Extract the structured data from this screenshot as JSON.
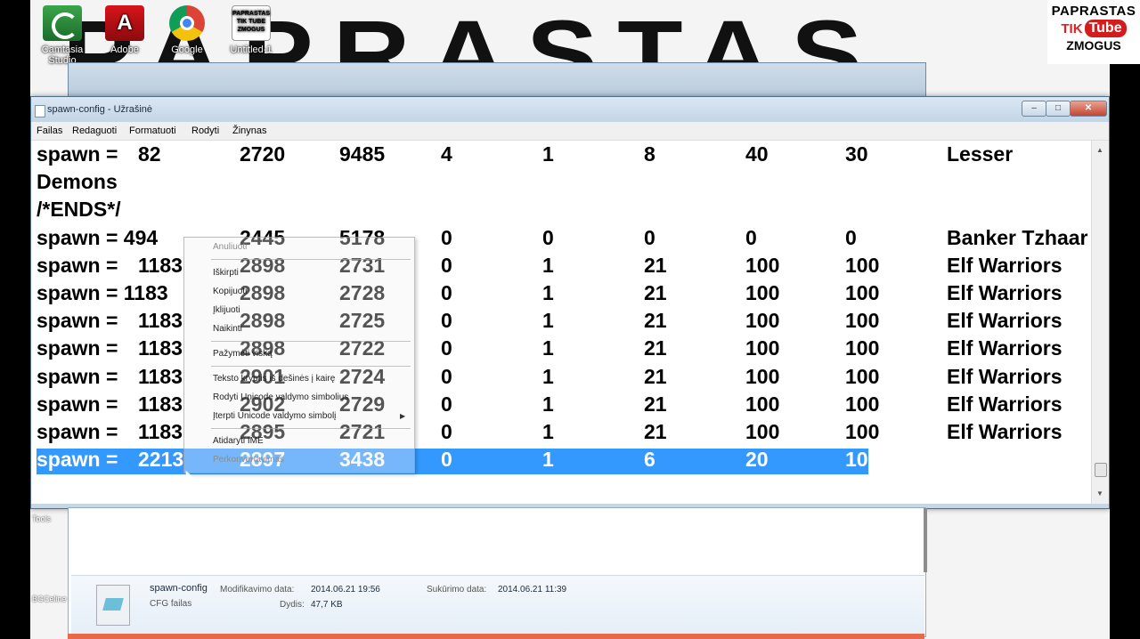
{
  "desktop": {
    "wallpaper_text": "PAPRASTAS",
    "icons": [
      {
        "label": "Camtasia Studio",
        "icon": "camtasia-icon"
      },
      {
        "label": "Adobe",
        "icon": "adobe-icon"
      },
      {
        "label": "Google",
        "icon": "chrome-icon"
      },
      {
        "label": "Untitled-1",
        "icon": "untitled-icon"
      }
    ],
    "untitled_thumb_text": "PAPRASTAS TIK TUBE ZMOGUS",
    "left_icons": [
      "Tools",
      "BGCeline"
    ]
  },
  "logo": {
    "line1": "PAPRASTAS",
    "tik": "TIK",
    "tube": "Tube",
    "line3": "ZMOGUS"
  },
  "notepad": {
    "title": "spawn-config - Užrašinė",
    "controls": {
      "minimize": "–",
      "maximize": "□",
      "close": "✕"
    },
    "menu": [
      "Failas",
      "Redaguoti",
      "Formatuoti",
      "Rodyti",
      "Žinynas"
    ],
    "lines": [
      [
        "spawn =",
        "82",
        "2720",
        "9485",
        "4",
        "1",
        "8",
        "40",
        "30",
        "Lesser"
      ],
      [
        "Demons"
      ],
      [
        "/*ENDS*/"
      ],
      [
        "spawn = 494",
        "",
        "2445",
        "5178",
        "0",
        "0",
        "0",
        "0",
        "0",
        "Banker Tzhaar"
      ],
      [
        "spawn =",
        "1183",
        "2898",
        "2731",
        "0",
        "1",
        "21",
        "100",
        "100",
        "Elf Warriors"
      ],
      [
        "spawn = 1183",
        "",
        "2898",
        "2728",
        "0",
        "1",
        "21",
        "100",
        "100",
        "Elf Warriors"
      ],
      [
        "spawn =",
        "1183",
        "2898",
        "2725",
        "0",
        "1",
        "21",
        "100",
        "100",
        "Elf Warriors"
      ],
      [
        "spawn =",
        "1183",
        "2898",
        "2722",
        "0",
        "1",
        "21",
        "100",
        "100",
        "Elf Warriors"
      ],
      [
        "spawn =",
        "1183",
        "2901",
        "2724",
        "0",
        "1",
        "21",
        "100",
        "100",
        "Elf Warriors"
      ],
      [
        "spawn =",
        "1183",
        "2902",
        "2729",
        "0",
        "1",
        "21",
        "100",
        "100",
        "Elf Warriors"
      ],
      [
        "spawn =",
        "1183",
        "2895",
        "2721",
        "0",
        "1",
        "21",
        "100",
        "100",
        "Elf Warriors"
      ],
      [
        "spawn =",
        "2213",
        "2897",
        "3438",
        "0",
        "1",
        "6",
        "20",
        "10",
        ""
      ]
    ]
  },
  "context_menu": {
    "items": [
      {
        "label": "Anuliuoti",
        "enabled": false
      },
      {
        "label": "Iškirpti",
        "enabled": true
      },
      {
        "label": "Kopijuoti",
        "enabled": true
      },
      {
        "label": "Įklijuoti",
        "enabled": true
      },
      {
        "label": "Naikinti",
        "enabled": true
      },
      {
        "label": "Pažymėti viską",
        "enabled": true
      },
      {
        "label": "Teksto kryptis iš dešinės į kairę",
        "enabled": true
      },
      {
        "label": "Rodyti Unicode valdymo simbolius",
        "enabled": true
      },
      {
        "label": "Įterpti Unicode valdymo simbolį",
        "enabled": true
      },
      {
        "label": "Atidaryti IME",
        "enabled": true
      },
      {
        "label": "Perkonvertavimas",
        "enabled": false
      }
    ]
  },
  "explorer_details": {
    "filename": "spawn-config",
    "type": "CFG failas",
    "modified_label": "Modifikavimo data:",
    "modified_value": "2014.06.21 19:56",
    "size_label": "Dydis:",
    "size_value": "47,7 KB",
    "created_label": "Sukūrimo data:",
    "created_value": "2014.06.21 11:39"
  }
}
